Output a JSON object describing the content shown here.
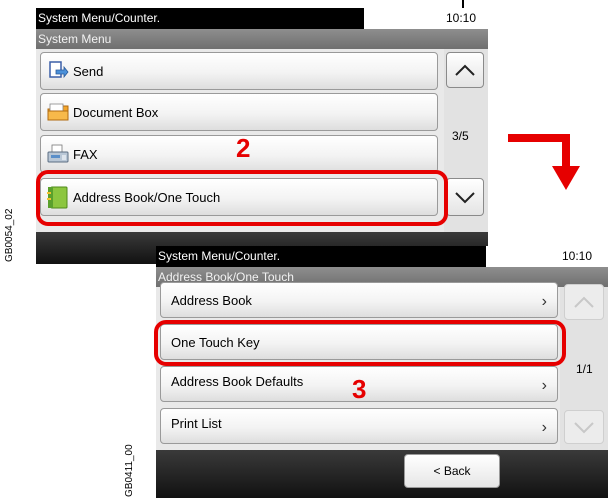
{
  "screen1": {
    "title": "System Menu/Counter.",
    "time": "10:10",
    "subtitle": "System Menu",
    "items": [
      {
        "label": "Send",
        "icon": "send-icon"
      },
      {
        "label": "Document Box",
        "icon": "document-box-icon"
      },
      {
        "label": "FAX",
        "icon": "fax-icon"
      },
      {
        "label": "Address Book/One Touch",
        "icon": "address-book-icon"
      }
    ],
    "page_indicator": "3/5",
    "step": "2",
    "side_label": "GB0054_02"
  },
  "screen2": {
    "title": "System Menu/Counter.",
    "time": "10:10",
    "subtitle": "Address Book/One Touch",
    "items": [
      {
        "label": "Address Book"
      },
      {
        "label": "One Touch Key"
      },
      {
        "label": "Address Book Defaults"
      },
      {
        "label": "Print List"
      }
    ],
    "page_indicator": "1/1",
    "back_label": "< Back",
    "step": "3",
    "side_label": "GB0411_00"
  },
  "colors": {
    "highlight": "#e60000",
    "titlebar": "#000000",
    "subtitle_bar": "#7a7a7a",
    "button_face": "#f3f3f3"
  }
}
